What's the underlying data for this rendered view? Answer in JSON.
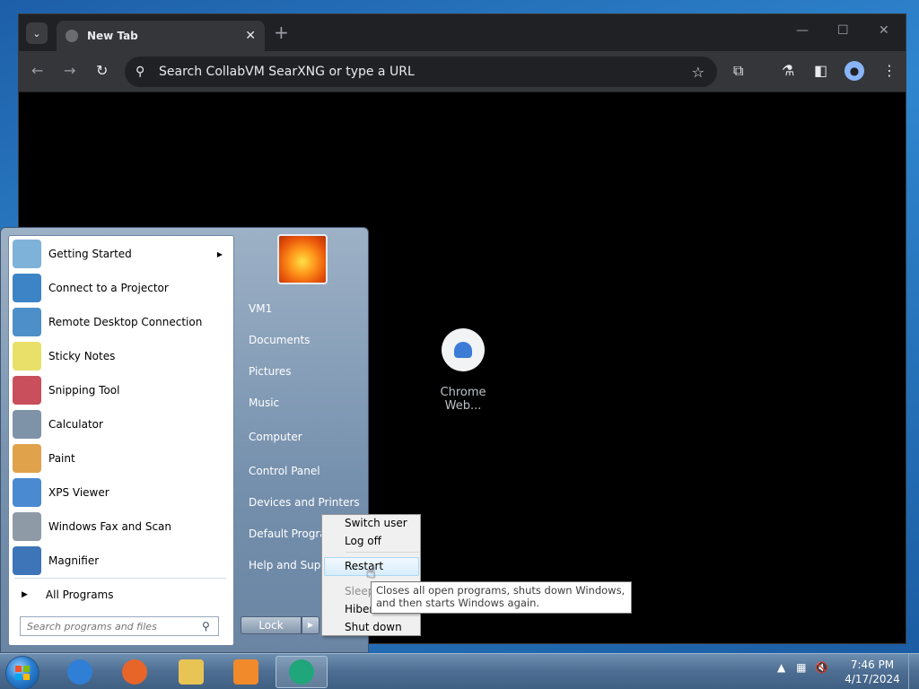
{
  "browser": {
    "tab_title": "New Tab",
    "tab_close": "✕",
    "new_tab": "+",
    "omnibox_placeholder": "Search CollabVM SearXNG or type a URL",
    "shortcut_label": "Chrome Web..."
  },
  "start_menu": {
    "programs": [
      {
        "label": "Getting Started",
        "icon": "getting-started-icon",
        "color": "#7fb2d8",
        "submenu": true
      },
      {
        "label": "Connect to a Projector",
        "icon": "projector-icon",
        "color": "#3d84c6",
        "submenu": false
      },
      {
        "label": "Remote Desktop Connection",
        "icon": "remote-desktop-icon",
        "color": "#4d8fc9",
        "submenu": false
      },
      {
        "label": "Sticky Notes",
        "icon": "sticky-notes-icon",
        "color": "#e9e06a",
        "submenu": false
      },
      {
        "label": "Snipping Tool",
        "icon": "scissors-icon",
        "color": "#c94f5c",
        "submenu": false
      },
      {
        "label": "Calculator",
        "icon": "calculator-icon",
        "color": "#7f93a8",
        "submenu": false
      },
      {
        "label": "Paint",
        "icon": "paint-icon",
        "color": "#e0a24a",
        "submenu": false
      },
      {
        "label": "XPS Viewer",
        "icon": "xps-viewer-icon",
        "color": "#4a8ad0",
        "submenu": false
      },
      {
        "label": "Windows Fax and Scan",
        "icon": "fax-scan-icon",
        "color": "#8e9aa6",
        "submenu": false
      },
      {
        "label": "Magnifier",
        "icon": "magnifier-icon",
        "color": "#3e74b8",
        "submenu": false
      }
    ],
    "all_programs": "All Programs",
    "search_placeholder": "Search programs and files",
    "right_items": [
      "VM1",
      "Documents",
      "Pictures",
      "Music",
      "Computer",
      "Control Panel",
      "Devices and Printers",
      "Default Programs",
      "Help and Support"
    ],
    "lock_label": "Lock"
  },
  "shutdown_menu": {
    "items": [
      "Switch user",
      "Log off",
      "Restart",
      "Sleep",
      "Hibernate",
      "Shut down"
    ],
    "highlighted": "Restart",
    "tooltip": "Closes all open programs, shuts down Windows, and then starts Windows again."
  },
  "taskbar": {
    "apps": [
      {
        "name": "internet-explorer",
        "color": "#2f7fd6"
      },
      {
        "name": "firefox",
        "color": "#e8652a"
      },
      {
        "name": "file-explorer",
        "color": "#e8c455"
      },
      {
        "name": "media-player",
        "color": "#f08a2a"
      },
      {
        "name": "chrome",
        "color": "#1fa67a"
      }
    ],
    "time": "7:46 PM",
    "date": "4/17/2024"
  }
}
